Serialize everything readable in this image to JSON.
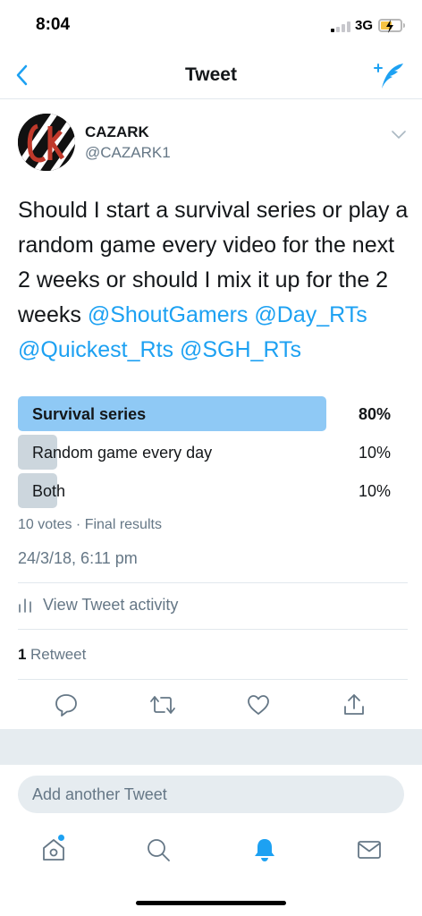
{
  "status_bar": {
    "time": "8:04",
    "network": "3G",
    "signal_bars_active": 1,
    "signal_bars_total": 4,
    "battery_level": 0.55,
    "battery_charging": true,
    "battery_color": "#f6c343"
  },
  "nav": {
    "title": "Tweet",
    "back_icon": "chevron-left-icon",
    "compose_icon": "compose-feather-icon",
    "accent": "#1da1f2"
  },
  "tweet": {
    "author": {
      "display_name": "CAZARK",
      "handle": "@CAZARK1"
    },
    "text_parts": [
      {
        "text": "Should I start a survival series or play a random game every video for the next 2 weeks or should I mix it up for the 2 weeks ",
        "mention": false
      },
      {
        "text": "@ShoutGamers",
        "mention": true
      },
      {
        "text": " ",
        "mention": false
      },
      {
        "text": "@Day_RTs",
        "mention": true
      },
      {
        "text": " ",
        "mention": false
      },
      {
        "text": "@Quickest_Rts",
        "mention": true
      },
      {
        "text": " ",
        "mention": false
      },
      {
        "text": "@SGH_RTs",
        "mention": true
      }
    ],
    "poll": {
      "options": [
        {
          "label": "Survival series",
          "percent": "80%",
          "fraction": 0.8,
          "winner": true
        },
        {
          "label": "Random game every day",
          "percent": "10%",
          "fraction": 0.1,
          "winner": false
        },
        {
          "label": "Both",
          "percent": "10%",
          "fraction": 0.1,
          "winner": false
        }
      ],
      "winner_color": "#8fc9f5",
      "other_color": "#ccd6dd",
      "meta": "10 votes · Final results"
    },
    "timestamp": "24/3/18, 6:11 pm",
    "activity_label": "View Tweet activity",
    "retweets": {
      "count": "1",
      "label": "Retweet"
    }
  },
  "actions": [
    {
      "name": "reply-icon"
    },
    {
      "name": "retweet-icon"
    },
    {
      "name": "like-icon"
    },
    {
      "name": "share-icon"
    }
  ],
  "reply": {
    "placeholder": "Add another Tweet"
  },
  "tabs": [
    {
      "name": "home-icon",
      "badge": true
    },
    {
      "name": "search-icon"
    },
    {
      "name": "notifications-icon",
      "active": true
    },
    {
      "name": "messages-icon"
    }
  ]
}
